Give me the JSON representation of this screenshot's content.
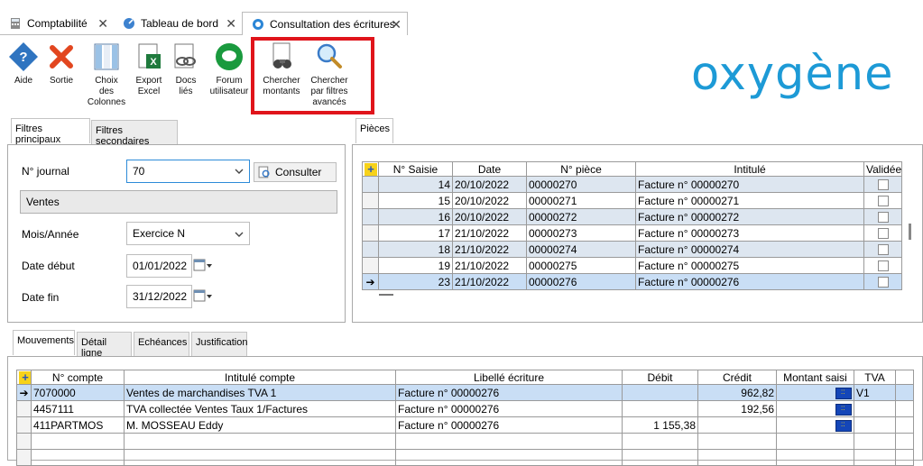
{
  "tabs": [
    {
      "label": "Comptabilité",
      "icon": "calculator-icon",
      "active": false
    },
    {
      "label": "Tableau de bord",
      "icon": "dashboard-icon",
      "active": false
    },
    {
      "label": "Consultation des écritures",
      "icon": "consultation-icon",
      "active": true
    }
  ],
  "toolbar": {
    "aide": "Aide",
    "sortie": "Sortie",
    "choix_line1": "Choix",
    "choix_line2": "des",
    "choix_line3": "Colonnes",
    "export_line1": "Export",
    "export_line2": "Excel",
    "docs_line1": "Docs",
    "docs_line2": "liés",
    "forum_line1": "Forum",
    "forum_line2": "utilisateur",
    "chercher_montants_line1": "Chercher",
    "chercher_montants_line2": "montants",
    "chercher_filtres_line1": "Chercher",
    "chercher_filtres_line2": "par filtres",
    "chercher_filtres_line3": "avancés"
  },
  "logo": "oxygène",
  "filters": {
    "tab_principal": "Filtres principaux",
    "tab_secondaire": "Filtres secondaires",
    "journal_label": "N° journal",
    "journal_value": "70",
    "consulter_label": "Consulter",
    "journal_name": "Ventes",
    "mois_label": "Mois/Année",
    "mois_value": "Exercice N",
    "debut_label": "Date début",
    "debut_value": "01/01/2022",
    "fin_label": "Date fin",
    "fin_value": "31/12/2022"
  },
  "pieces": {
    "tab_label": "Pièces",
    "columns": [
      "N° Saisie",
      "Date",
      "N° pièce",
      "Intitulé",
      "Validée"
    ],
    "rows": [
      {
        "saisie": "14",
        "date": "20/10/2022",
        "piece": "00000270",
        "intitule": "Facture n° 00000270"
      },
      {
        "saisie": "15",
        "date": "20/10/2022",
        "piece": "00000271",
        "intitule": "Facture n° 00000271"
      },
      {
        "saisie": "16",
        "date": "20/10/2022",
        "piece": "00000272",
        "intitule": "Facture n° 00000272"
      },
      {
        "saisie": "17",
        "date": "21/10/2022",
        "piece": "00000273",
        "intitule": "Facture n° 00000273"
      },
      {
        "saisie": "18",
        "date": "21/10/2022",
        "piece": "00000274",
        "intitule": "Facture n° 00000274"
      },
      {
        "saisie": "19",
        "date": "21/10/2022",
        "piece": "00000275",
        "intitule": "Facture n° 00000275"
      },
      {
        "saisie": "23",
        "date": "21/10/2022",
        "piece": "00000276",
        "intitule": "Facture n° 00000276"
      }
    ]
  },
  "movements": {
    "tabs": [
      "Mouvements",
      "Détail ligne",
      "Echéances",
      "Justification"
    ],
    "columns": [
      "N° compte",
      "Intitulé compte",
      "Libellé écriture",
      "Débit",
      "Crédit",
      "Montant saisi",
      "TVA"
    ],
    "rows": [
      {
        "compte": "7070000",
        "intitule": "Ventes de marchandises TVA 1",
        "libelle": "Facture n° 00000276",
        "debit": "",
        "credit": "962,82",
        "tva": "V1"
      },
      {
        "compte": "4457111",
        "intitule": "TVA collectée Ventes Taux 1/Factures",
        "libelle": "Facture n° 00000276",
        "debit": "",
        "credit": "192,56",
        "tva": ""
      },
      {
        "compte": "411PARTMOS",
        "intitule": "M. MOSSEAU Eddy",
        "libelle": "Facture n° 00000276",
        "debit": "1 155,38",
        "credit": "",
        "tva": ""
      }
    ]
  },
  "colors": {
    "accent": "#1d9ad6",
    "highlight": "#e0141b",
    "selected_row": "#c9def5",
    "alt_row": "#dde6f0"
  }
}
